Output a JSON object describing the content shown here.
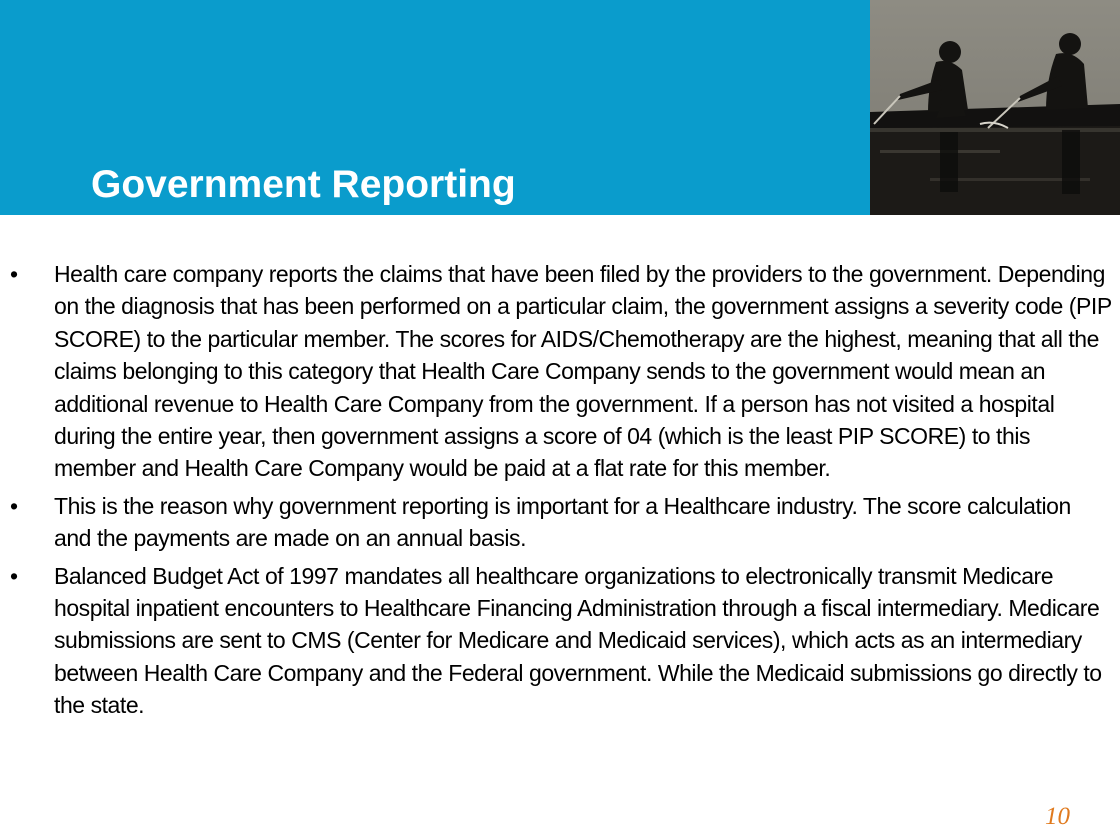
{
  "slide": {
    "title": "Government Reporting",
    "page_number": "10",
    "colors": {
      "header_band": "#0a9ccc",
      "title_text": "#ffffff",
      "page_number": "#e07a1e"
    },
    "photo": {
      "description_icon": "rowers-photo"
    },
    "bullets": [
      {
        "marker": "•",
        "text": "Health care company reports the claims that have been filed by the providers to the government. Depending on the diagnosis that has been performed on a particular claim, the government assigns a severity code (PIP SCORE) to the particular member. The scores for AIDS/Chemotherapy are the highest, meaning that all the claims belonging to this category that Health Care Company sends to the government would mean an additional revenue to Health Care Company from the government. If a person has not visited a hospital during the entire year, then government assigns a score of 04 (which is the least PIP SCORE) to this member and Health Care Company would be paid at a flat rate for this member."
      },
      {
        "marker": "•",
        "text": "This is the reason why government reporting is important for a Healthcare industry. The score calculation and the payments are made on an annual basis."
      },
      {
        "marker": "•",
        "text": "Balanced Budget Act of 1997 mandates all healthcare organizations to electronically transmit Medicare hospital inpatient encounters to Healthcare Financing Administration through a fiscal intermediary. Medicare submissions are sent to CMS (Center for Medicare and Medicaid services), which acts as an intermediary between Health Care Company and the Federal government. While the Medicaid submissions go directly to the state."
      }
    ]
  }
}
